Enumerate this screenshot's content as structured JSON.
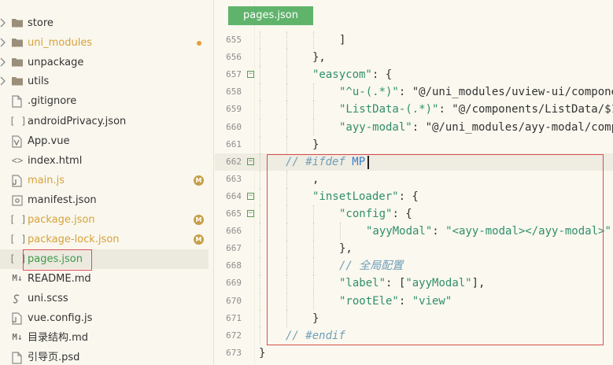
{
  "sidebar": {
    "items": [
      {
        "label": "store",
        "kind": "folder",
        "expandable": true,
        "status": ""
      },
      {
        "label": "uni_modules",
        "kind": "folder",
        "expandable": true,
        "status": "dot"
      },
      {
        "label": "unpackage",
        "kind": "folder",
        "expandable": true,
        "status": ""
      },
      {
        "label": "utils",
        "kind": "folder",
        "expandable": true,
        "status": ""
      },
      {
        "label": ".gitignore",
        "kind": "file",
        "status": ""
      },
      {
        "label": "androidPrivacy.json",
        "kind": "json",
        "status": ""
      },
      {
        "label": "App.vue",
        "kind": "vue",
        "status": ""
      },
      {
        "label": "index.html",
        "kind": "html",
        "status": ""
      },
      {
        "label": "main.js",
        "kind": "js",
        "status": "M"
      },
      {
        "label": "manifest.json",
        "kind": "manifest",
        "status": ""
      },
      {
        "label": "package.json",
        "kind": "json",
        "status": "M"
      },
      {
        "label": "package-lock.json",
        "kind": "json",
        "status": "M"
      },
      {
        "label": "pages.json",
        "kind": "json",
        "status": "",
        "selected": true
      },
      {
        "label": "README.md",
        "kind": "md",
        "status": ""
      },
      {
        "label": "uni.scss",
        "kind": "scss",
        "status": ""
      },
      {
        "label": "vue.config.js",
        "kind": "js",
        "status": ""
      },
      {
        "label": "目录结构.md",
        "kind": "md",
        "status": ""
      },
      {
        "label": "引导页.psd",
        "kind": "file",
        "status": ""
      }
    ],
    "badge_letter": "M",
    "icons": {
      "json": "[ ]",
      "html": "<>",
      "md": "M↓"
    }
  },
  "editor": {
    "tab_label": "pages.json",
    "lines": [
      {
        "num": "655",
        "fold": false,
        "indent": 3,
        "text": "]"
      },
      {
        "num": "656",
        "fold": false,
        "indent": 2,
        "text": "},"
      },
      {
        "num": "657",
        "fold": true,
        "indent": 2,
        "text": "\"easycom\": {"
      },
      {
        "num": "658",
        "fold": false,
        "indent": 3,
        "text": "\"^u-(.*)\": \"@/uni_modules/uview-ui/componer"
      },
      {
        "num": "659",
        "fold": false,
        "indent": 3,
        "text": "\"ListData-(.*)\": \"@/components/ListData/$1"
      },
      {
        "num": "660",
        "fold": false,
        "indent": 3,
        "text": "\"ayy-modal\": \"@/uni_modules/ayy-modal/compo"
      },
      {
        "num": "661",
        "fold": false,
        "indent": 2,
        "text": "}"
      },
      {
        "num": "662",
        "fold": true,
        "indent": 1,
        "text": "// #ifdef MP"
      },
      {
        "num": "663",
        "fold": false,
        "indent": 2,
        "text": ","
      },
      {
        "num": "664",
        "fold": true,
        "indent": 2,
        "text": "\"insetLoader\": {"
      },
      {
        "num": "665",
        "fold": true,
        "indent": 3,
        "text": "\"config\": {"
      },
      {
        "num": "666",
        "fold": false,
        "indent": 4,
        "text": "\"ayyModal\": \"<ayy-modal></ayy-modal>\""
      },
      {
        "num": "667",
        "fold": false,
        "indent": 3,
        "text": "},"
      },
      {
        "num": "668",
        "fold": false,
        "indent": 3,
        "text": "// 全局配置"
      },
      {
        "num": "669",
        "fold": false,
        "indent": 3,
        "text": "\"label\": [\"ayyModal\"],"
      },
      {
        "num": "670",
        "fold": false,
        "indent": 3,
        "text": "\"rootEle\": \"view\""
      },
      {
        "num": "671",
        "fold": false,
        "indent": 2,
        "text": "}"
      },
      {
        "num": "672",
        "fold": false,
        "indent": 1,
        "text": "// #endif"
      },
      {
        "num": "673",
        "fold": false,
        "indent": 0,
        "text": "}"
      }
    ]
  },
  "colors": {
    "accent_green": "#5fb36b",
    "highlight_red": "#d94c4c",
    "modified_badge": "#c79f49"
  }
}
